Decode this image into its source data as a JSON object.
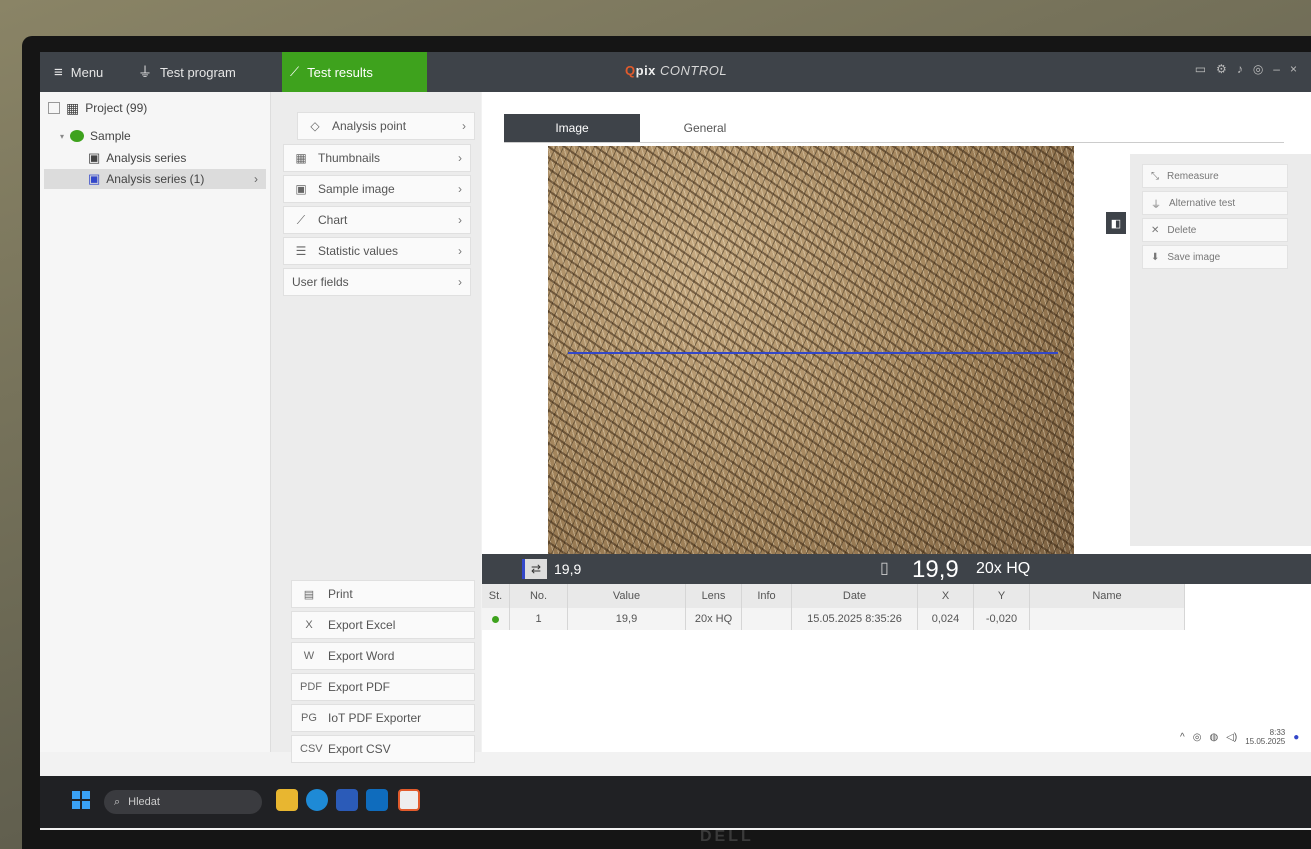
{
  "topbar": {
    "menu_label": "Menu",
    "test_program_label": "Test program",
    "test_results_label": "Test results",
    "logo_mark": "Q",
    "logo_brand": "pix",
    "logo_suffix": "CONTROL",
    "accent_color": "#3ea21d",
    "logo_color": "#e25b2c"
  },
  "tree": {
    "project": "Project (99)",
    "sample": "Sample",
    "series": "Analysis series",
    "series_selected": "Analysis series (1)"
  },
  "submenu": {
    "analysis_point": "Analysis point",
    "thumbnails": "Thumbnails",
    "sample_image": "Sample image",
    "chart": "Chart",
    "statistic_values": "Statistic values",
    "user_fields": "User fields"
  },
  "exports": {
    "print": "Print",
    "excel": "Export Excel",
    "word": "Export Word",
    "pdf": "Export PDF",
    "iot_pdf": "IoT PDF Exporter",
    "csv": "Export CSV",
    "icon_excel": "X",
    "icon_word": "W",
    "icon_pdf": "PDF",
    "icon_iot": "PG",
    "icon_csv": "CSV"
  },
  "tabs": {
    "image": "Image",
    "general": "General"
  },
  "actions": {
    "remeasure": "Remeasure",
    "alternative_test": "Alternative test",
    "delete": "Delete",
    "save_image": "Save image"
  },
  "result": {
    "small_value": "19,9",
    "large_value": "19,9",
    "lens": "20x HQ"
  },
  "table": {
    "headers": [
      "St.",
      "No.",
      "Value",
      "Lens",
      "Info",
      "Date",
      "X",
      "Y",
      "Name"
    ],
    "rows": [
      {
        "no": "1",
        "value": "19,9",
        "lens": "20x HQ",
        "info": "",
        "date": "15.05.2025 8:35:26",
        "x": "0,024",
        "y": "-0,020",
        "name": ""
      }
    ]
  },
  "tray": {
    "time": "8:33",
    "date": "15.05.2025"
  },
  "taskbar": {
    "search_placeholder": "Hledat"
  },
  "monitor_brand": "DELL"
}
